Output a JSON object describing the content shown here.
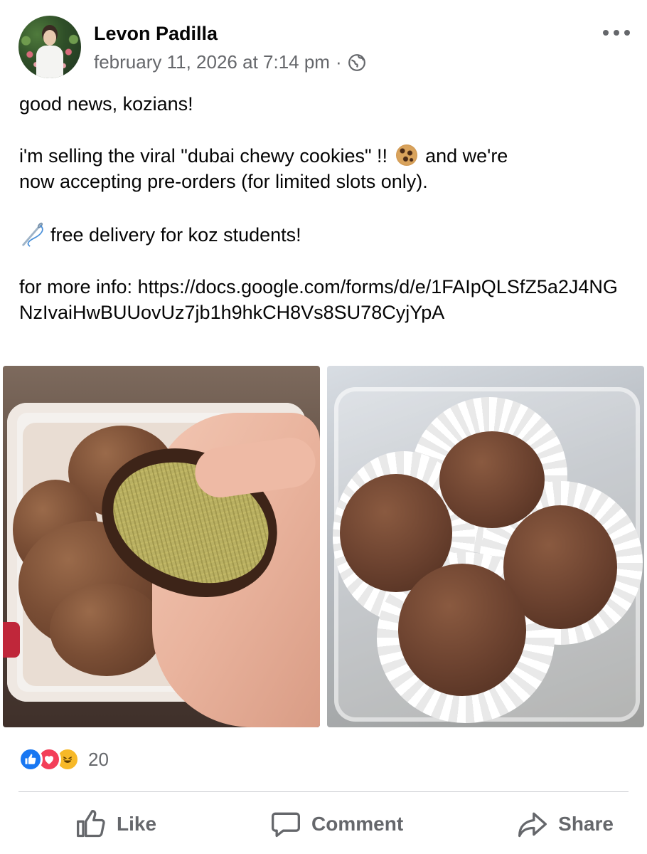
{
  "post": {
    "author": "Levon Padilla",
    "timestamp": "february 11, 2026 at 7:14 pm",
    "separator": "·",
    "audience_icon": "globe-icon",
    "menu_icon": "more-horizontal-icon",
    "text": {
      "line1": "good news, kozians!",
      "line2a": "i'm selling the viral \"dubai chewy cookies\" !!",
      "line2_emoji": "cookie",
      "line2b": "and we're",
      "line2c": "now accepting pre-orders (for limited slots only).",
      "line3_emoji": "sewing-needle",
      "line3": "free delivery for koz students!",
      "line4_prefix": "for more info: ",
      "line4_link": "https://docs.google.com/forms/d/e/1FAIpQLSfZ5a2J4NGNzIvaiHwBUUovUz7jb1h9hkCH8Vs8SU78CyjYpA"
    },
    "photos": [
      "cookie-cut-open-photo",
      "cookies-in-box-photo"
    ]
  },
  "reactions": {
    "types": [
      "like",
      "love",
      "haha"
    ],
    "count": "20"
  },
  "actions": {
    "like_label": "Like",
    "comment_label": "Comment",
    "share_label": "Share"
  },
  "colors": {
    "like_blue": "#1877f2",
    "love_red": "#f33e58",
    "haha_yellow": "#f7b928",
    "secondary_text": "#65676b"
  }
}
